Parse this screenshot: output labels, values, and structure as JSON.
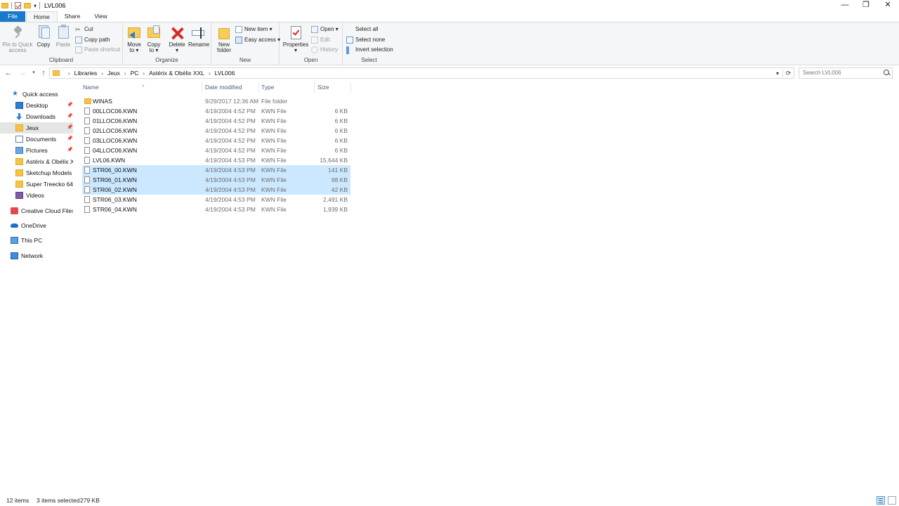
{
  "window": {
    "title": "LVL006",
    "controls": {
      "minimize": "—",
      "restore": "❐",
      "close": "✕"
    }
  },
  "tabs": {
    "file": "File",
    "home": "Home",
    "share": "Share",
    "view": "View"
  },
  "ribbon": {
    "clipboard": {
      "label": "Clipboard",
      "pin_line1": "Pin to Quick",
      "pin_line2": "access",
      "copy": "Copy",
      "paste": "Paste",
      "cut": "Cut",
      "copy_path": "Copy path",
      "paste_shortcut": "Paste shortcut"
    },
    "organize": {
      "label": "Organize",
      "move_line1": "Move",
      "move_line2": "to ▾",
      "copy_line1": "Copy",
      "copy_line2": "to ▾",
      "delete_line1": "Delete",
      "delete_line2": "▾",
      "rename": "Rename"
    },
    "new": {
      "label": "New",
      "new_folder_line1": "New",
      "new_folder_line2": "folder",
      "new_item": "New item ▾",
      "easy_access": "Easy access ▾"
    },
    "open": {
      "label": "Open",
      "properties_line1": "Properties",
      "properties_line2": "▾",
      "open": "Open ▾",
      "edit": "Edit",
      "history": "History"
    },
    "select": {
      "label": "Select",
      "select_all": "Select all",
      "select_none": "Select none",
      "invert_selection": "Invert selection"
    }
  },
  "address": {
    "crumbs": [
      "Libraries",
      "Jeux",
      "PC",
      "Astérix & Obélix XXL",
      "LVL006"
    ],
    "search_placeholder": "Search LVL006"
  },
  "nav": {
    "quick_access": "Quick access",
    "items": [
      {
        "label": "Desktop",
        "pinned": true
      },
      {
        "label": "Downloads",
        "pinned": true
      },
      {
        "label": "Jeux",
        "pinned": true
      },
      {
        "label": "Documents",
        "pinned": true
      },
      {
        "label": "Pictures",
        "pinned": true
      },
      {
        "label": "Astérix & Obélix XXL",
        "pinned": false
      },
      {
        "label": "Sketchup Models",
        "pinned": false
      },
      {
        "label": "Super Treecko 64",
        "pinned": false
      },
      {
        "label": "Videos",
        "pinned": false
      }
    ],
    "creative_cloud": "Creative Cloud Files",
    "onedrive": "OneDrive",
    "this_pc": "This PC",
    "network": "Network"
  },
  "columns": {
    "name": "Name",
    "date": "Date modified",
    "type": "Type",
    "size": "Size"
  },
  "files": [
    {
      "name": "WINAS",
      "date": "9/29/2017 12:36 AM",
      "type": "File folder",
      "size": ""
    },
    {
      "name": "00LLOC06.KWN",
      "date": "4/19/2004 4:52 PM",
      "type": "KWN File",
      "size": "6 KB"
    },
    {
      "name": "01LLOC06.KWN",
      "date": "4/19/2004 4:52 PM",
      "type": "KWN File",
      "size": "6 KB"
    },
    {
      "name": "02LLOC06.KWN",
      "date": "4/19/2004 4:52 PM",
      "type": "KWN File",
      "size": "6 KB"
    },
    {
      "name": "03LLOC06.KWN",
      "date": "4/19/2004 4:52 PM",
      "type": "KWN File",
      "size": "6 KB"
    },
    {
      "name": "04LLOC06.KWN",
      "date": "4/19/2004 4:52 PM",
      "type": "KWN File",
      "size": "6 KB"
    },
    {
      "name": "LVL06.KWN",
      "date": "4/19/2004 4:53 PM",
      "type": "KWN File",
      "size": "15,644 KB"
    },
    {
      "name": "STR06_00.KWN",
      "date": "4/19/2004 4:53 PM",
      "type": "KWN File",
      "size": "141 KB"
    },
    {
      "name": "STR06_01.KWN",
      "date": "4/19/2004 4:53 PM",
      "type": "KWN File",
      "size": "98 KB"
    },
    {
      "name": "STR06_02.KWN",
      "date": "4/19/2004 4:53 PM",
      "type": "KWN File",
      "size": "42 KB"
    },
    {
      "name": "STR06_03.KWN",
      "date": "4/19/2004 4:53 PM",
      "type": "KWN File",
      "size": "2,491 KB"
    },
    {
      "name": "STR06_04.KWN",
      "date": "4/19/2004 4:53 PM",
      "type": "KWN File",
      "size": "1,939 KB"
    }
  ],
  "status": {
    "items": "12 items",
    "selected": "3 items selected",
    "selected_size": "279 KB"
  },
  "colors": {
    "accent": "#1979ca",
    "selection": "#cce8ff",
    "ribbon_bg": "#f5f6f7"
  }
}
